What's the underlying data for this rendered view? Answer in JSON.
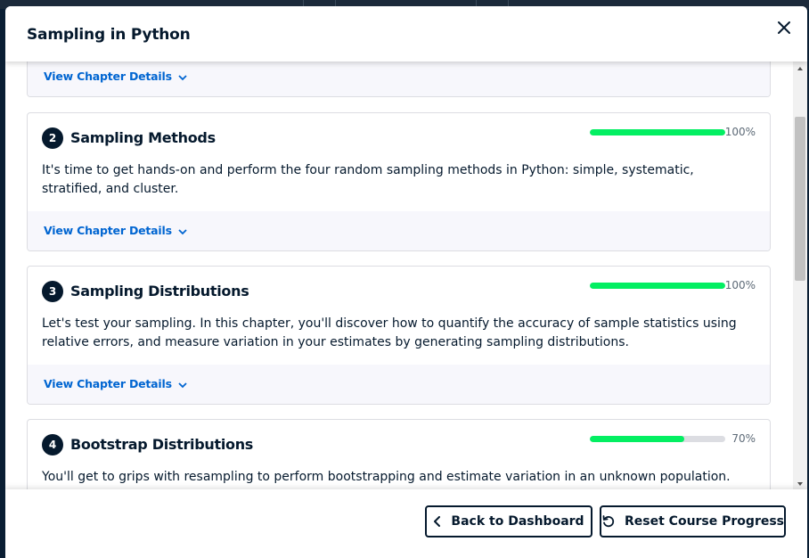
{
  "modal": {
    "title": "Sampling in Python"
  },
  "chapters": [
    {
      "view_details_label": "View Chapter Details"
    },
    {
      "number": "2",
      "title": "Sampling Methods",
      "progress": 1.0,
      "progress_label": "100%",
      "description": "It's time to get hands-on and perform the four random sampling methods in Python: simple, systematic, stratified, and cluster.",
      "view_details_label": "View Chapter Details"
    },
    {
      "number": "3",
      "title": "Sampling Distributions",
      "progress": 1.0,
      "progress_label": "100%",
      "description": "Let's test your sampling. In this chapter, you'll discover how to quantify the accuracy of sample statistics using relative errors, and measure variation in your estimates by generating sampling distributions.",
      "view_details_label": "View Chapter Details"
    },
    {
      "number": "4",
      "title": "Bootstrap Distributions",
      "progress": 0.7,
      "progress_label": "70%",
      "description": "You'll get to grips with resampling to perform bootstrapping and estimate variation in an unknown population. You'll learn the difference between sampling distributions and bootstrap distributions using resampling."
    }
  ],
  "footer": {
    "back_label": "Back to Dashboard",
    "reset_label": "Reset Course Progress"
  },
  "colors": {
    "progress_fill": "#03ef62",
    "link": "#0065d1",
    "navy": "#05192d"
  },
  "icons": {
    "close": "close-icon",
    "chevron": "chevron-down-icon",
    "back": "chevron-left-icon",
    "reset": "reset-icon"
  }
}
